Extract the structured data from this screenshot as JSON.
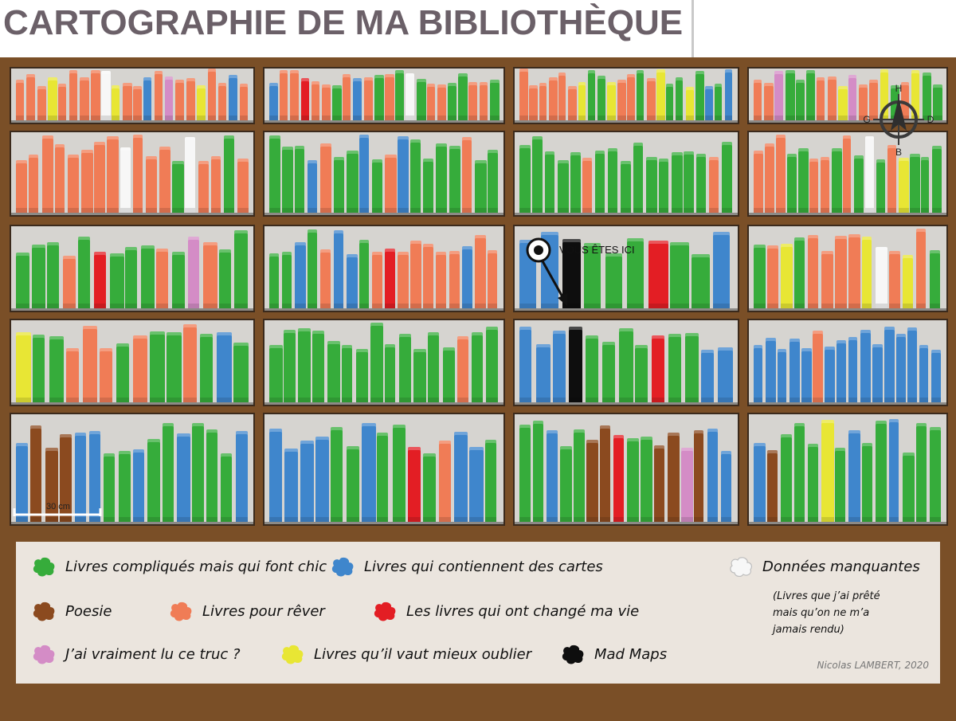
{
  "title": "CARTOGRAPHIE DE MA BIBLIOTHÈQUE",
  "you_are_here": "VOUS ÊTES ICI",
  "scale": {
    "label": "30 cm"
  },
  "compass": {
    "n": "H",
    "s": "B",
    "w": "G",
    "e": "D"
  },
  "colors": {
    "green": "#36ac3b",
    "blue": "#3f86cc",
    "brown": "#8b4a1f",
    "orange": "#f07c56",
    "red": "#e31e24",
    "pink": "#d48cc6",
    "yellow": "#e8e634",
    "black": "#0e0e0e",
    "white": "#f7f7f7",
    "wood": "#7a4f27"
  },
  "legend": {
    "items": [
      {
        "color": "#36ac3b",
        "label": "Livres compliqués mais qui font chic"
      },
      {
        "color": "#3f86cc",
        "label": "Livres qui contiennent des cartes"
      },
      {
        "color": "#f7f7f7",
        "label": "Données manquantes"
      },
      {
        "color": "#8b4a1f",
        "label": "Poesie"
      },
      {
        "color": "#f07c56",
        "label": "Livres pour rêver"
      },
      {
        "color": "#e31e24",
        "label": "Les livres qui ont changé ma vie"
      },
      {
        "color": "#d48cc6",
        "label": "J’ai vraiment lu ce truc ?"
      },
      {
        "color": "#e8e634",
        "label": "Livres qu’il vaut mieux oublier"
      },
      {
        "color": "#0e0e0e",
        "label": "Mad Maps"
      }
    ],
    "note": "(Livres que j’ai prêté\nmais qu’on ne m’a\njamais rendu)",
    "credit": "Nicolas LAMBERT, 2020"
  },
  "shelves": [
    [
      "OOOYOOOOWYOOBOPOOYOOBO",
      "BOOROOGOBOGOGWGOOGGOOG",
      "OOOOOOYGGYOOGOYGGYGBGB",
      "OOPGGGOOYPOOYGOYGG"
    ],
    [
      "OOOOOOOOWOOOGWOOGO",
      "GGGBOGGBGOBGGGGOGG",
      "GGGGGOGGGGGGGGGOG",
      "OOOGGOOGOGWGOYGGG"
    ],
    [
      "GGGOGRGGGOGPOGG",
      "GGBGOBBGOROOOOOBOO",
      "BBKGGGRGGB",
      "GOYGOOOOYWOYOG"
    ],
    [
      "YGGOOOGOGGOGBG",
      "GGGGGGGGGGGGGOGG",
      "BBBKGGGGRGGBB",
      "BBBBBOBBBBBBBBBB"
    ],
    [
      "BNNNBBGGBGGBGGGB",
      "BBBBGGBGGRGOBBG",
      "GGBGGNNRGGNNPNBB",
      "BNGGGYGBGGBGGG"
    ]
  ]
}
